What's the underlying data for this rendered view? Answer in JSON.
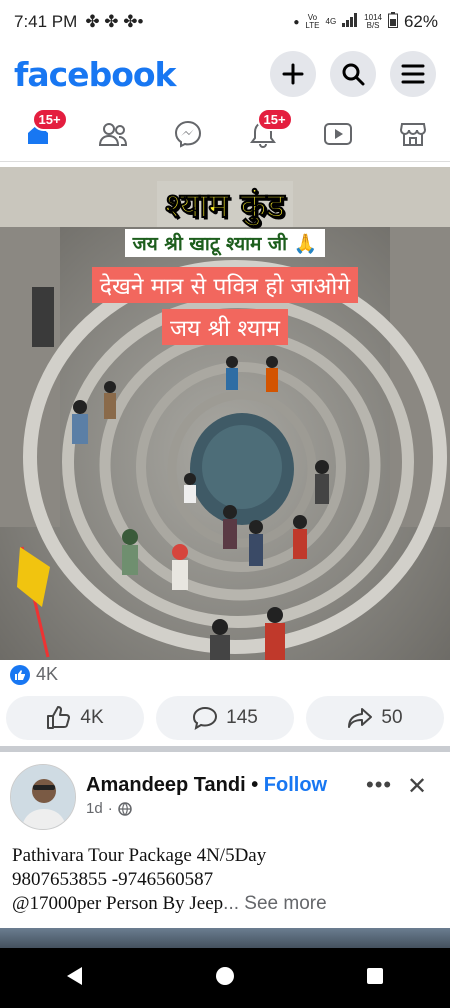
{
  "status": {
    "time": "7:41 PM",
    "carrier_top": "Vo",
    "carrier_bottom": "LTE",
    "net_top": "4G",
    "speed_top": "1014",
    "speed_bottom": "B/S",
    "battery": "62%"
  },
  "app": {
    "logo": "facebook",
    "brand_color": "#1877f2"
  },
  "tabs": {
    "home_badge": "15+",
    "notif_badge": "15+"
  },
  "post": {
    "caption_title": "श्याम कुंड",
    "caption_sub": "जय श्री खाटू श्याम जी 🙏",
    "caption_line1": "देखने मात्र से पवित्र हो जाओगे",
    "caption_line2": "जय श्री श्याम",
    "reaction_count": "4K",
    "like_count": "4K",
    "comment_count": "145",
    "share_count": "50"
  },
  "post2": {
    "author": "Amandeep Tandi",
    "dot": "•",
    "follow": "Follow",
    "time": "1d",
    "more": "•••",
    "close": "✕",
    "line1": "Pathivara Tour Package 4N/5Day",
    "line2": "9807653855 -9746560587",
    "line3": "@17000per Person By Jeep",
    "see_more": "... See more"
  }
}
